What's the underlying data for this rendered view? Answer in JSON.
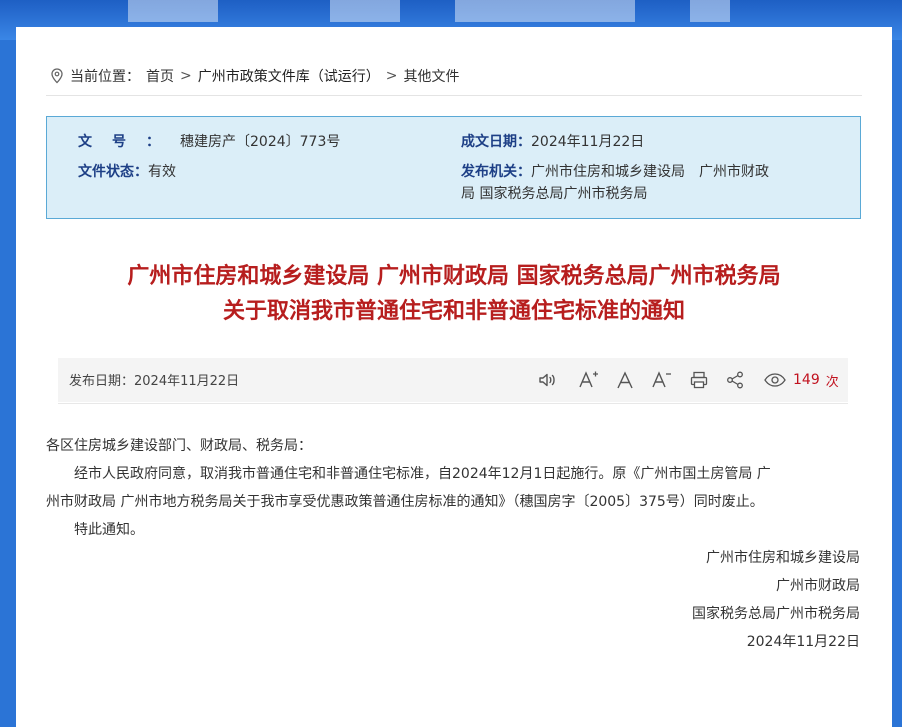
{
  "breadcrumb": {
    "prefix": "当前位置：",
    "home": "首页",
    "sep1": ">",
    "library": "广州市政策文件库（试运行）",
    "sep2": ">",
    "current": "其他文件"
  },
  "meta": {
    "doc_no_label": "文号：",
    "doc_no_value": "穗建房产〔2024〕773号",
    "status_label": "文件状态：",
    "status_value": "有效",
    "date_label": "成文日期：",
    "date_value": "2024年11月22日",
    "issuer_label": "发布机关：",
    "issuer_line1": "广州市住房和城乡建设局　广州市财政",
    "issuer_line2": "局 国家税务总局广州市税务局"
  },
  "title": {
    "line1": "广州市住房和城乡建设局 广州市财政局 国家税务总局广州市税务局",
    "line2": "关于取消我市普通住宅和非普通住宅标准的通知"
  },
  "toolbar": {
    "publish_date": "发布日期：2024年11月22日",
    "icons": [
      "speaker-icon",
      "font-increase-icon",
      "font-normal-icon",
      "font-decrease-icon",
      "print-icon",
      "share-icon"
    ],
    "views_count": "149",
    "views_unit": "次",
    "accent": "#c1121f"
  },
  "body": {
    "salutation": "各区住房城乡建设部门、财政局、税务局：",
    "para1_line1": "　　经市人民政府同意，取消我市普通住宅和非普通住宅标准，自2024年12月1日起施行。原《广州市国土房管局 广",
    "para1_line2": "州市财政局 广州市地方税务局关于我市享受优惠政策普通住房标准的通知》（穗国房字〔2005〕375号）同时废止。",
    "para2": "　　特此通知。"
  },
  "signature": {
    "org1": "广州市住房和城乡建设局",
    "org2": "广州市财政局",
    "org3": "国家税务总局广州市税务局",
    "date": "2024年11月22日"
  },
  "colors": {
    "title_red": "#b71e1e",
    "label_blue": "#1d3f86",
    "meta_bg": "#dbeef8",
    "meta_border": "#5aa9d6"
  }
}
